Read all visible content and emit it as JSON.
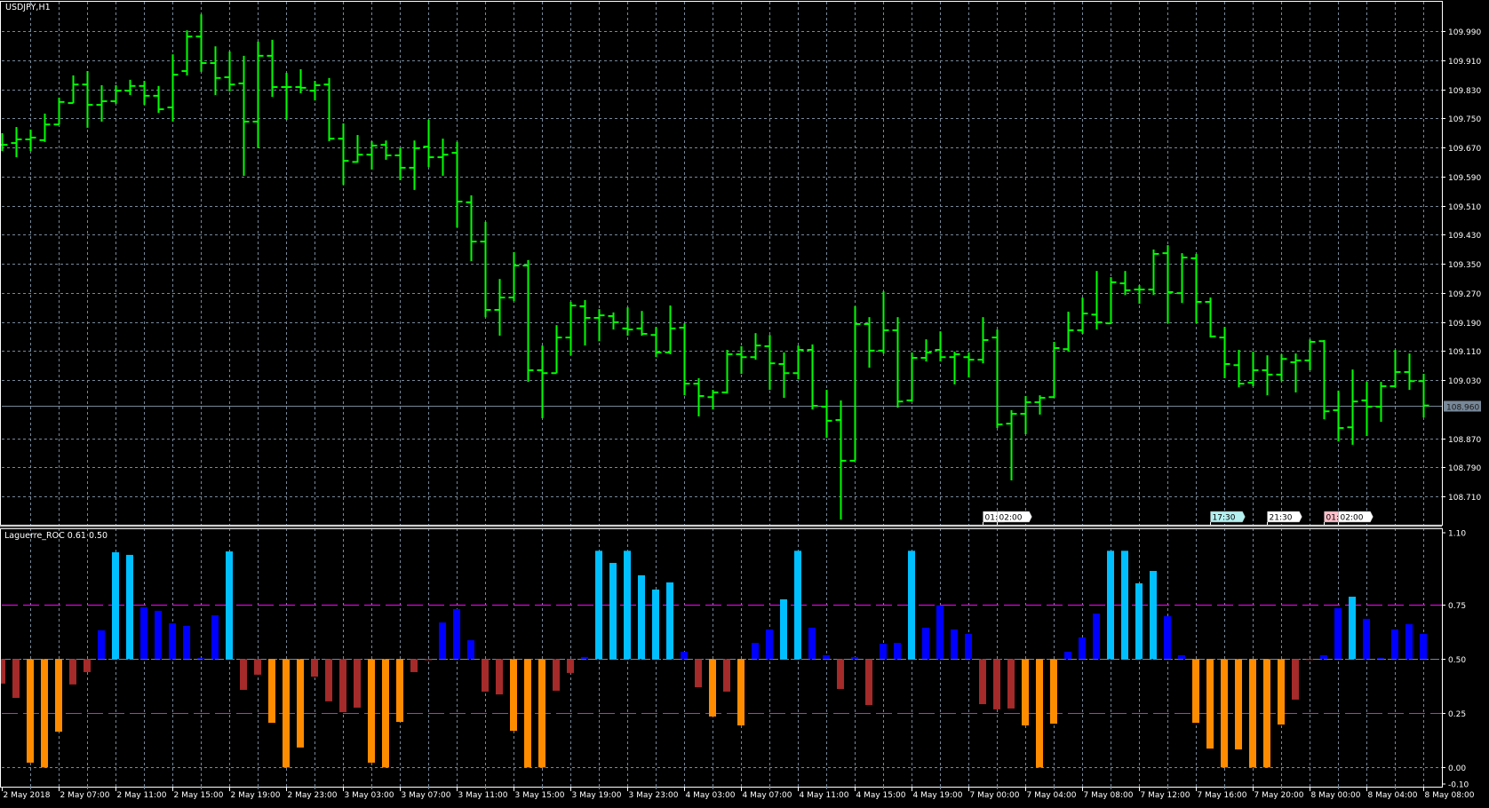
{
  "window": {
    "symbol_label": "USDJPY,H1",
    "indicator_label": "Laguerre_ROC 0.61 0.50",
    "current_price_label": "108.960"
  },
  "colors": {
    "background": "#000000",
    "grid": "#778899",
    "bars": "#00ff00",
    "frame": "#ffffff",
    "level": "#ff00ff",
    "hist_strong_up": "#00bfff",
    "hist_up": "#0000ff",
    "hist_down": "#a52a2a",
    "hist_strong_down": "#ff8c00",
    "price_tag": "#778899"
  },
  "time_markers": [
    {
      "bar": 69,
      "text": "01:",
      "color": "#ffffff"
    },
    {
      "bar": 70,
      "text": "02:00",
      "color": "#ffffff"
    },
    {
      "bar": 85,
      "text": "17:30",
      "color": "#b4f0f0"
    },
    {
      "bar": 89,
      "text": "21:30",
      "color": "#ffffff"
    },
    {
      "bar": 93,
      "text": "01:",
      "color": "#ffc0cb"
    },
    {
      "bar": 94,
      "text": "02:00",
      "color": "#ffffff"
    }
  ],
  "chart_data": [
    {
      "type": "ohlc",
      "title": "USDJPY,H1",
      "ylim": [
        108.65,
        110.04
      ],
      "y_ticks": [
        "109.990",
        "109.910",
        "109.830",
        "109.750",
        "109.670",
        "109.590",
        "109.510",
        "109.430",
        "109.350",
        "109.270",
        "109.190",
        "109.110",
        "109.030",
        "108.870",
        "108.790",
        "108.710"
      ],
      "current_price": 108.96,
      "x_tick_every_bars": 4,
      "x_ticks": [
        "2 May 2018",
        "2 May 07:00",
        "2 May 11:00",
        "2 May 15:00",
        "2 May 19:00",
        "2 May 23:00",
        "3 May 03:00",
        "3 May 07:00",
        "3 May 11:00",
        "3 May 15:00",
        "3 May 19:00",
        "3 May 23:00",
        "4 May 03:00",
        "4 May 07:00",
        "4 May 11:00",
        "4 May 15:00",
        "4 May 19:00",
        "7 May 00:00",
        "7 May 04:00",
        "7 May 08:00",
        "7 May 12:00",
        "7 May 16:00",
        "7 May 20:00",
        "8 May 00:00",
        "8 May 04:00",
        "8 May 08:00"
      ],
      "ohlc": [
        [
          109.677,
          109.709,
          109.66,
          109.677
        ],
        [
          109.682,
          109.726,
          109.643,
          109.692
        ],
        [
          109.692,
          109.719,
          109.66,
          109.697
        ],
        [
          109.69,
          109.763,
          109.685,
          109.733
        ],
        [
          109.733,
          109.807,
          109.733,
          109.795
        ],
        [
          109.792,
          109.868,
          109.792,
          109.843
        ],
        [
          109.843,
          109.88,
          109.724,
          109.787
        ],
        [
          109.787,
          109.841,
          109.741,
          109.797
        ],
        [
          109.797,
          109.841,
          109.79,
          109.826
        ],
        [
          109.826,
          109.856,
          109.814,
          109.839
        ],
        [
          109.839,
          109.853,
          109.787,
          109.812
        ],
        [
          109.812,
          109.839,
          109.765,
          109.775
        ],
        [
          109.78,
          109.926,
          109.741,
          109.87
        ],
        [
          109.88,
          109.992,
          109.868,
          109.975
        ],
        [
          109.975,
          110.036,
          109.878,
          109.902
        ],
        [
          109.902,
          109.948,
          109.814,
          109.861
        ],
        [
          109.863,
          109.934,
          109.824,
          109.843
        ],
        [
          109.846,
          109.922,
          109.592,
          109.741
        ],
        [
          109.741,
          109.961,
          109.668,
          109.922
        ],
        [
          109.922,
          109.966,
          109.809,
          109.836
        ],
        [
          109.836,
          109.875,
          109.746,
          109.836
        ],
        [
          109.836,
          109.885,
          109.819,
          109.834
        ],
        [
          109.826,
          109.853,
          109.799,
          109.841
        ],
        [
          109.843,
          109.861,
          109.687,
          109.694
        ],
        [
          109.694,
          109.736,
          109.567,
          109.633
        ],
        [
          109.63,
          109.704,
          109.628,
          109.65
        ],
        [
          109.65,
          109.687,
          109.609,
          109.675
        ],
        [
          109.677,
          109.689,
          109.636,
          109.648
        ],
        [
          109.648,
          109.67,
          109.58,
          109.614
        ],
        [
          109.614,
          109.689,
          109.553,
          109.668
        ],
        [
          109.672,
          109.746,
          109.616,
          109.643
        ],
        [
          109.643,
          109.694,
          109.592,
          109.65
        ],
        [
          109.655,
          109.685,
          109.45,
          109.521
        ],
        [
          109.519,
          109.538,
          109.357,
          109.411
        ],
        [
          109.411,
          109.465,
          109.203,
          109.223
        ],
        [
          109.223,
          109.308,
          109.152,
          109.257
        ],
        [
          109.257,
          109.382,
          109.247,
          109.345
        ],
        [
          109.345,
          109.36,
          109.025,
          109.057
        ],
        [
          109.057,
          109.125,
          108.925,
          109.049
        ],
        [
          109.049,
          109.181,
          109.049,
          109.147
        ],
        [
          109.147,
          109.245,
          109.098,
          109.235
        ],
        [
          109.233,
          109.25,
          109.125,
          109.201
        ],
        [
          109.201,
          109.225,
          109.137,
          109.208
        ],
        [
          109.206,
          109.216,
          109.169,
          109.189
        ],
        [
          109.172,
          109.23,
          109.152,
          109.169
        ],
        [
          109.172,
          109.22,
          109.152,
          109.157
        ],
        [
          109.154,
          109.176,
          109.093,
          109.106
        ],
        [
          109.106,
          109.235,
          109.101,
          109.172
        ],
        [
          109.174,
          109.186,
          108.988,
          109.02
        ],
        [
          109.02,
          109.035,
          108.93,
          108.986
        ],
        [
          108.983,
          109.003,
          108.949,
          108.996
        ],
        [
          108.996,
          109.113,
          108.993,
          109.101
        ],
        [
          109.101,
          109.123,
          109.047,
          109.093
        ],
        [
          109.093,
          109.159,
          109.086,
          109.125
        ],
        [
          109.123,
          109.154,
          109.003,
          109.076
        ],
        [
          109.074,
          109.106,
          108.981,
          109.049
        ],
        [
          109.049,
          109.125,
          109.032,
          109.113
        ],
        [
          109.113,
          109.128,
          108.949,
          108.959
        ],
        [
          108.957,
          109.003,
          108.871,
          108.918
        ],
        [
          108.92,
          108.974,
          108.646,
          108.808
        ],
        [
          108.808,
          109.233,
          108.808,
          109.184
        ],
        [
          109.184,
          109.203,
          109.064,
          109.111
        ],
        [
          109.111,
          109.274,
          109.103,
          109.167
        ],
        [
          109.167,
          109.203,
          108.954,
          108.971
        ],
        [
          108.974,
          109.106,
          108.971,
          109.091
        ],
        [
          109.091,
          109.142,
          109.081,
          109.106
        ],
        [
          109.113,
          109.164,
          109.081,
          109.093
        ],
        [
          109.093,
          109.108,
          109.018,
          109.101
        ],
        [
          109.093,
          109.106,
          109.037,
          109.086
        ],
        [
          109.086,
          109.203,
          109.076,
          109.14
        ],
        [
          109.147,
          109.169,
          108.898,
          108.908
        ],
        [
          108.91,
          108.947,
          108.754,
          108.937
        ],
        [
          108.937,
          108.986,
          108.881,
          108.969
        ],
        [
          108.969,
          108.988,
          108.935,
          108.981
        ],
        [
          108.983,
          109.135,
          108.981,
          109.118
        ],
        [
          109.115,
          109.218,
          109.108,
          109.167
        ],
        [
          109.167,
          109.257,
          109.157,
          109.213
        ],
        [
          109.21,
          109.33,
          109.169,
          109.189
        ],
        [
          109.186,
          109.313,
          109.184,
          109.299
        ],
        [
          109.296,
          109.33,
          109.264,
          109.277
        ],
        [
          109.279,
          109.291,
          109.24,
          109.279
        ],
        [
          109.279,
          109.389,
          109.264,
          109.377
        ],
        [
          109.379,
          109.401,
          109.186,
          109.272
        ],
        [
          109.269,
          109.379,
          109.242,
          109.367
        ],
        [
          109.365,
          109.377,
          109.186,
          109.245
        ],
        [
          109.245,
          109.257,
          109.147,
          109.15
        ],
        [
          109.147,
          109.176,
          109.035,
          109.074
        ],
        [
          109.071,
          109.113,
          109.01,
          109.02
        ],
        [
          109.023,
          109.108,
          109.013,
          109.057
        ],
        [
          109.057,
          109.098,
          108.988,
          109.045
        ],
        [
          109.045,
          109.101,
          109.027,
          109.088
        ],
        [
          109.079,
          109.103,
          108.996,
          109.084
        ],
        [
          109.084,
          109.142,
          109.057,
          109.135
        ],
        [
          109.137,
          109.14,
          108.922,
          108.944
        ],
        [
          108.947,
          109.001,
          108.861,
          108.898
        ],
        [
          108.9,
          109.059,
          108.852,
          108.971
        ],
        [
          108.974,
          109.025,
          108.876,
          108.957
        ],
        [
          108.957,
          109.025,
          108.915,
          109.013
        ],
        [
          109.013,
          109.113,
          109.01,
          109.052
        ],
        [
          109.052,
          109.103,
          109.003,
          109.027
        ],
        [
          109.027,
          109.047,
          108.927,
          108.96
        ]
      ]
    },
    {
      "type": "bar",
      "title": "Laguerre_ROC 0.61 0.50",
      "ylim": [
        -0.1,
        1.1
      ],
      "baseline": 0.5,
      "levels": [
        0.75,
        0.25
      ],
      "y_ticks": [
        "1.10",
        "0.75",
        "0.50",
        "0.25",
        "0.00",
        "-0.10"
      ],
      "values": [
        0.387,
        0.321,
        0.022,
        0.0,
        0.165,
        0.383,
        0.44,
        0.633,
        0.993,
        0.981,
        0.739,
        0.723,
        0.665,
        0.653,
        0.505,
        0.702,
        0.997,
        0.358,
        0.428,
        0.206,
        0.0,
        0.092,
        0.419,
        0.305,
        0.255,
        0.276,
        0.022,
        0.0,
        0.21,
        0.44,
        0.495,
        0.669,
        0.731,
        0.587,
        0.35,
        0.337,
        0.169,
        0.0,
        0.0,
        0.354,
        0.436,
        0.51,
        1.0,
        0.944,
        1.0,
        0.887,
        0.821,
        0.854,
        0.534,
        0.37,
        0.235,
        0.35,
        0.194,
        0.575,
        0.637,
        0.776,
        1.0,
        0.645,
        0.518,
        0.362,
        0.51,
        0.288,
        0.571,
        0.575,
        1.0,
        0.645,
        0.748,
        0.637,
        0.616,
        0.292,
        0.268,
        0.272,
        0.194,
        0.0,
        0.202,
        0.534,
        0.6,
        0.71,
        1.0,
        1.0,
        0.85,
        0.907,
        0.698,
        0.518,
        0.206,
        0.087,
        0.0,
        0.083,
        0.0,
        0.0,
        0.198,
        0.313,
        0.497,
        0.518,
        0.735,
        0.788,
        0.686,
        0.505,
        0.637,
        0.661,
        0.616
      ]
    }
  ]
}
